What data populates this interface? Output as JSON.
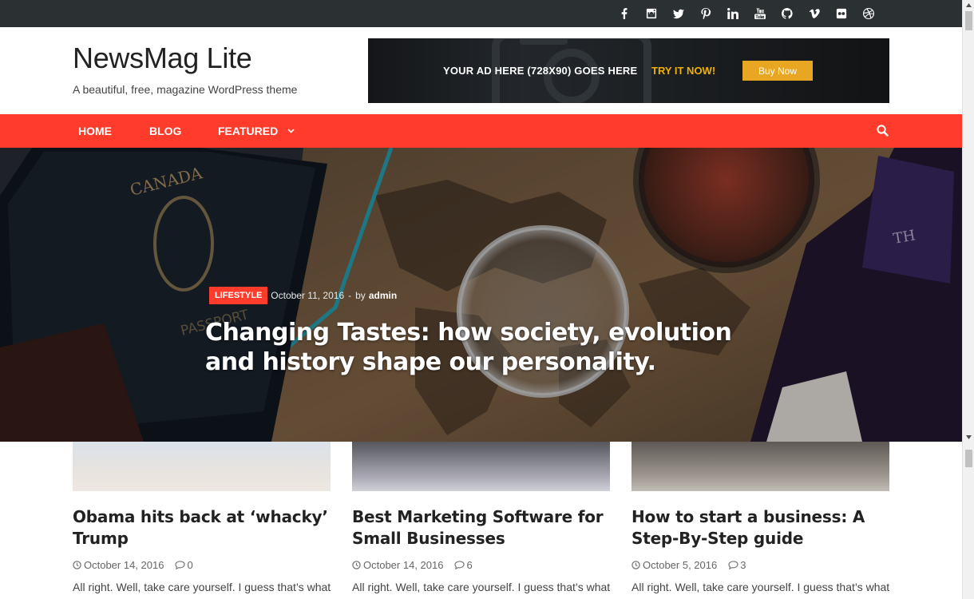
{
  "social_icons": [
    {
      "name": "facebook-icon"
    },
    {
      "name": "instagram-icon"
    },
    {
      "name": "twitter-icon"
    },
    {
      "name": "pinterest-icon"
    },
    {
      "name": "linkedin-icon"
    },
    {
      "name": "youtube-icon"
    },
    {
      "name": "github-icon"
    },
    {
      "name": "vimeo-icon"
    },
    {
      "name": "flickr-icon"
    },
    {
      "name": "dribbble-icon"
    }
  ],
  "header": {
    "site_title": "NewsMag Lite",
    "tagline": "A beautiful, free, magazine WordPress theme"
  },
  "ad": {
    "text": "YOUR AD HERE (728X90) GOES HERE",
    "cta_text": "TRY IT NOW!",
    "button_label": "Buy Now",
    "accent_color": "#e9a622"
  },
  "nav": {
    "items": [
      "HOME",
      "BLOG",
      "FEATURED"
    ],
    "bar_color": "#ff3b2b",
    "search_icon": "search-icon"
  },
  "hero": {
    "category": "LIFESTYLE",
    "date": "October 11, 2016",
    "separator": "-",
    "by": "by",
    "author": "admin",
    "title": "Changing Tastes: how society, evolution and history shape our personality."
  },
  "cards": [
    {
      "title": "Obama hits back at ‘whacky’ Trump",
      "date": "October 14, 2016",
      "comments": "0",
      "excerpt": "All right. Well, take care yourself. I guess that’s what"
    },
    {
      "title": "Best Marketing Software for Small Businesses",
      "date": "October 14, 2016",
      "comments": "6",
      "excerpt": "All right. Well, take care yourself. I guess that’s what"
    },
    {
      "title": "How to start a business: A Step-By-Step guide",
      "date": "October 5, 2016",
      "comments": "3",
      "excerpt": "All right. Well, take care yourself. I guess that’s what"
    }
  ]
}
